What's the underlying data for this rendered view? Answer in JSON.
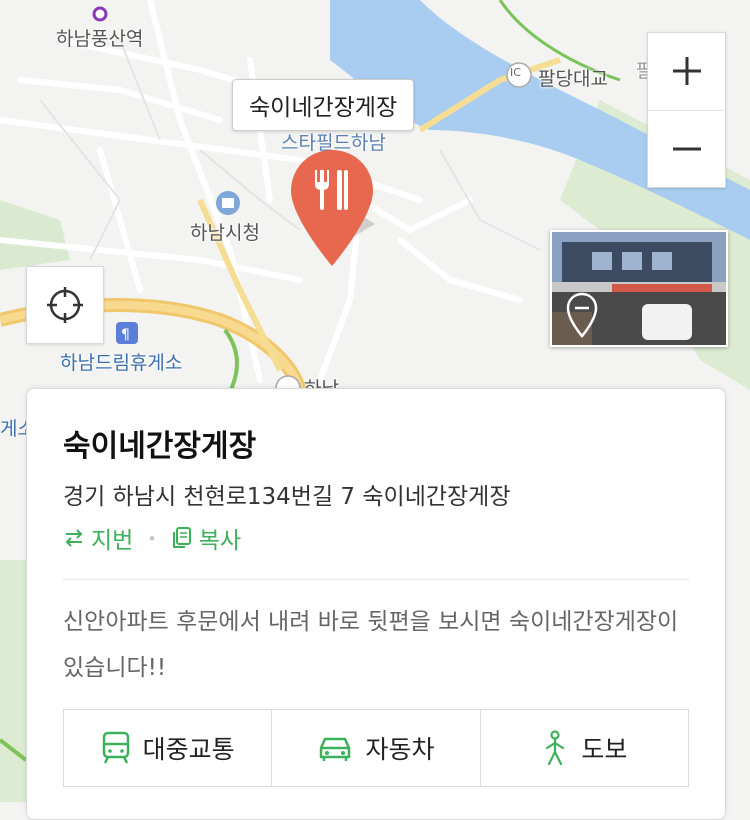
{
  "map": {
    "labels": {
      "station": "하남풍산역",
      "ic_paldang": "팔당대교",
      "ic_badge": "IC",
      "paldang_cut": "팔당",
      "starfield": "스타필드하남",
      "cityhall": "하남시청",
      "restarea": "하남드림휴게소",
      "restarea_cut": "게소",
      "ic_hanam": "하남"
    },
    "callout": "숙이네간장게장",
    "colors": {
      "water": "#a9cdf0",
      "park": "#d9ead0",
      "road": "#ffffff",
      "highway": "#f0c76a",
      "pin": "#e8674f",
      "accent": "#3cb05a"
    }
  },
  "controls": {
    "zoom_in": "+",
    "zoom_out": "−"
  },
  "place": {
    "name": "숙이네간장게장",
    "address": "경기 하남시 천현로134번길 7 숙이네간장게장",
    "toggle_label": "지번",
    "copy_label": "복사",
    "description": "신안아파트 후문에서 내려 바로 뒷편을 보시면 숙이네간장게장이 있습니다!!",
    "routes": [
      {
        "label": "대중교통",
        "icon": "bus-icon"
      },
      {
        "label": "자동차",
        "icon": "car-icon"
      },
      {
        "label": "도보",
        "icon": "walk-icon"
      }
    ]
  }
}
